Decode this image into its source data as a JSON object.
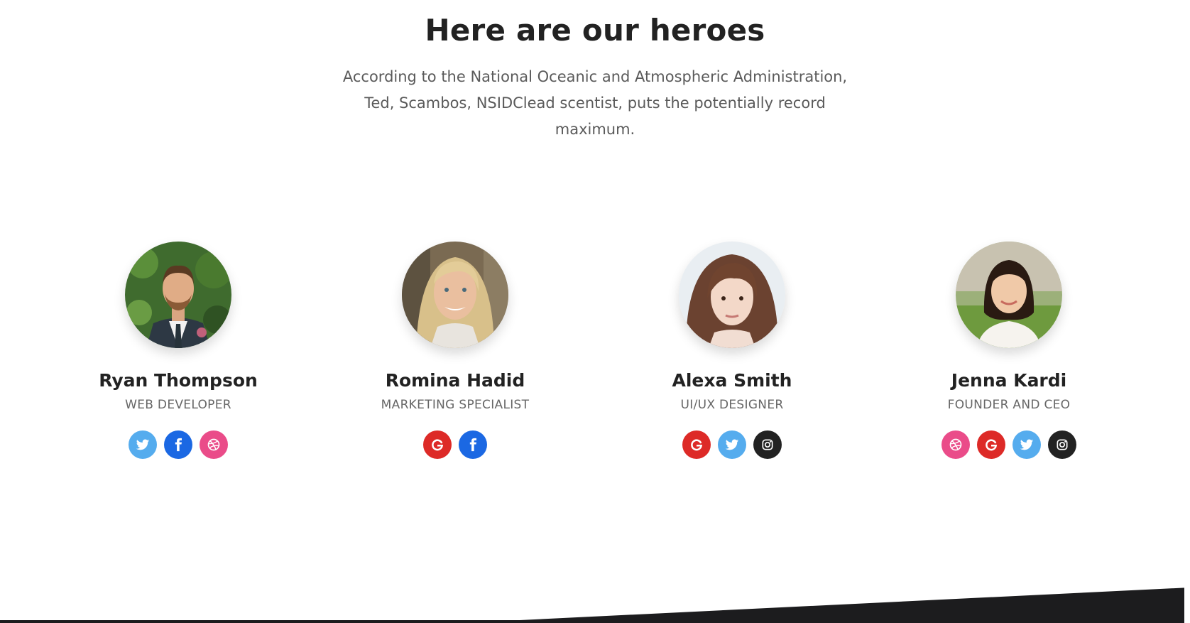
{
  "section": {
    "title": "Here are our heroes",
    "description": "According to the National Oceanic and Atmospheric Administration, Ted, Scambos, NSIDClead scentist, puts the potentially record maximum."
  },
  "members": [
    {
      "name": "Ryan Thompson",
      "role": "WEB DEVELOPER",
      "socials": [
        "twitter",
        "facebook",
        "dribbble"
      ]
    },
    {
      "name": "Romina Hadid",
      "role": "MARKETING SPECIALIST",
      "socials": [
        "google",
        "facebook"
      ]
    },
    {
      "name": "Alexa Smith",
      "role": "UI/UX DESIGNER",
      "socials": [
        "google",
        "twitter",
        "instagram"
      ]
    },
    {
      "name": "Jenna Kardi",
      "role": "FOUNDER AND CEO",
      "socials": [
        "dribbble",
        "google",
        "twitter",
        "instagram"
      ]
    }
  ],
  "colors": {
    "twitter": "#55acee",
    "facebook": "#1b68e3",
    "dribbble": "#ea4c89",
    "google": "#dd2a27",
    "instagram": "#222222",
    "footer": "#1c1c1e"
  }
}
